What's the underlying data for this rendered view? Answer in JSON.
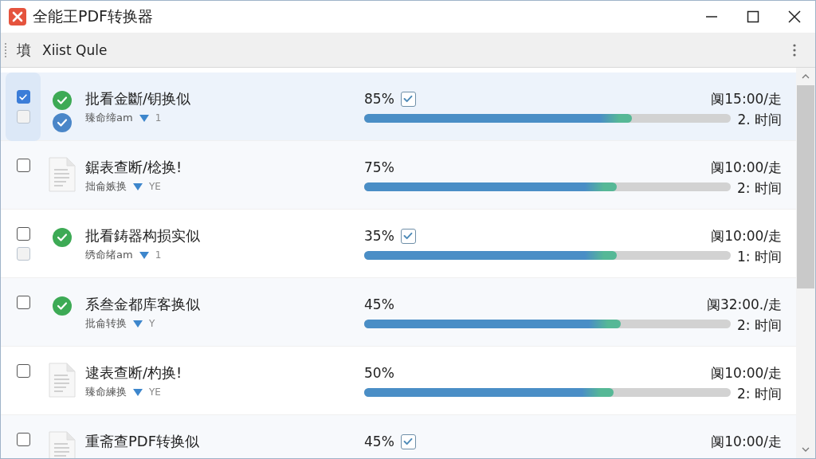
{
  "window": {
    "title": "全能王PDF转换器"
  },
  "toolbar": {
    "icon_char": "墳",
    "label": "Xiist Qule"
  },
  "rows": [
    {
      "selected": true,
      "checked": true,
      "extra_checked": false,
      "kind": "done",
      "synced": true,
      "title": "批看金斷/钥换似",
      "sub": "臻命缔am",
      "sub_tag": "1",
      "percent": "85%",
      "confirm_checked": true,
      "level": 0.73,
      "time": "阒15:00/走",
      "remaining": "2. 时间"
    },
    {
      "selected": false,
      "checked": false,
      "kind": "file",
      "synced": false,
      "title": "鋸表查断/棯换!",
      "sub": "拙侖嫉换",
      "sub_tag": "YE",
      "percent": "75%",
      "level": 0.69,
      "time": "阒10:00/走",
      "remaining": "2: 时间"
    },
    {
      "selected": false,
      "checked": false,
      "extra_checked": false,
      "kind": "done",
      "synced": false,
      "title": "批看鋳器构损实似",
      "sub": "绣命绪am",
      "sub_tag": "1",
      "percent": "35%",
      "confirm_checked": true,
      "level": 0.69,
      "time": "阒10:00/走",
      "remaining": "1: 时间"
    },
    {
      "selected": false,
      "checked": false,
      "kind": "done",
      "synced": false,
      "title": "系叁金都库客换似",
      "sub": "批侖转换",
      "sub_tag": "Y",
      "percent": "45%",
      "level": 0.7,
      "time": "阒32:00./走",
      "remaining": "2: 时间"
    },
    {
      "selected": false,
      "checked": false,
      "kind": "file",
      "synced": false,
      "title": "逮表查断/杓换!",
      "sub": "臻命練换",
      "sub_tag": "YE",
      "percent": "50%",
      "level": 0.68,
      "time": "阒10:00/走",
      "remaining": "2: 时间"
    },
    {
      "selected": false,
      "checked": false,
      "kind": "file",
      "synced": false,
      "title": "重斋查PDF转换似",
      "percent": "45%",
      "confirm_checked": true,
      "time": "阒10:00/走"
    }
  ]
}
